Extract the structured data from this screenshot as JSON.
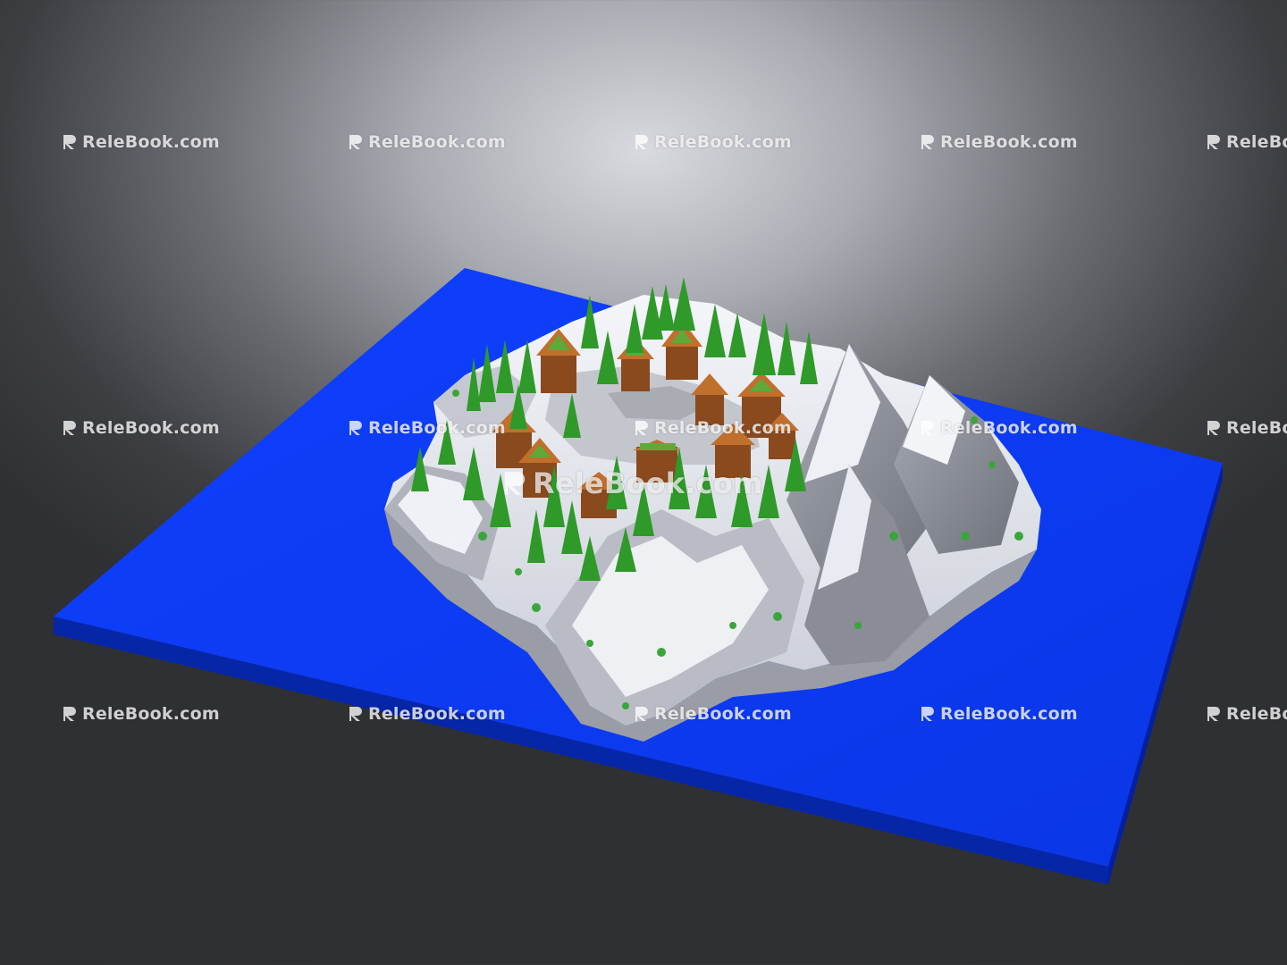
{
  "watermark": {
    "text": "ReleBook.com",
    "text_clipped": "ReleBo"
  },
  "colors": {
    "water": "#0a3cf0",
    "water_edge": "#0626a8",
    "snow": "#e6e9f0",
    "rock": "#8d9099",
    "tree": "#2f9a2a",
    "roof": "#c0702c",
    "background_light": "#d9dadf",
    "background_dark": "#2f3033"
  }
}
